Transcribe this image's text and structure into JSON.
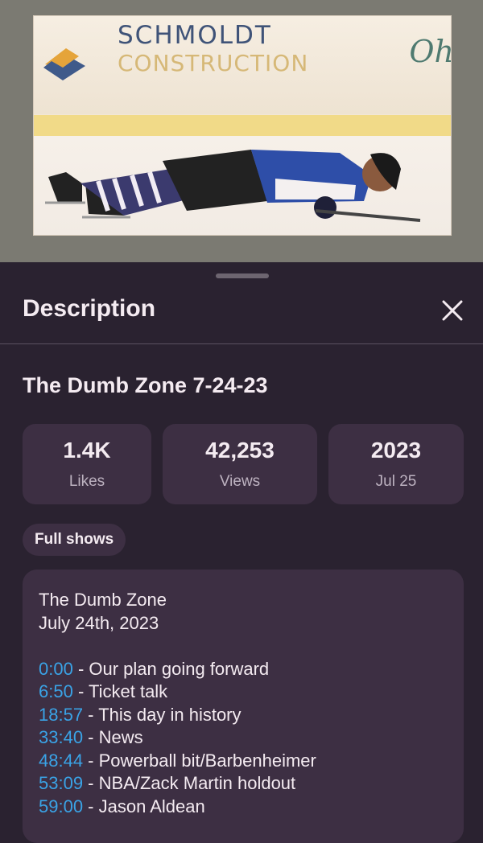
{
  "thumbnail": {
    "sponsor_name": "SCHMOLDT",
    "sponsor_sub": "CONSTRUCTION",
    "sponsor_right": "Oh"
  },
  "sheet": {
    "title": "Description",
    "close_icon": "close-icon"
  },
  "video": {
    "title": "The Dumb Zone 7-24-23"
  },
  "stats": {
    "likes_value": "1.4K",
    "likes_label": "Likes",
    "views_value": "42,253",
    "views_label": "Views",
    "year": "2023",
    "date": "Jul 25"
  },
  "chip": {
    "label": "Full shows"
  },
  "description": {
    "line1": "The Dumb Zone",
    "line2": "July 24th, 2023",
    "chapters": [
      {
        "time": "0:00",
        "text": " - Our plan going forward"
      },
      {
        "time": "6:50",
        "text": " - Ticket talk"
      },
      {
        "time": "18:57",
        "text": " - This day in history"
      },
      {
        "time": "33:40",
        "text": " - News"
      },
      {
        "time": "48:44",
        "text": " - Powerball bit/Barbenheimer"
      },
      {
        "time": "53:09",
        "text": " - NBA/Zack Martin holdout"
      },
      {
        "time": "59:00",
        "text": " - Jason Aldean"
      }
    ]
  },
  "colors": {
    "sheet_bg": "#2a2230",
    "card_bg": "#3d2f43",
    "timestamp": "#3aa3e6"
  }
}
